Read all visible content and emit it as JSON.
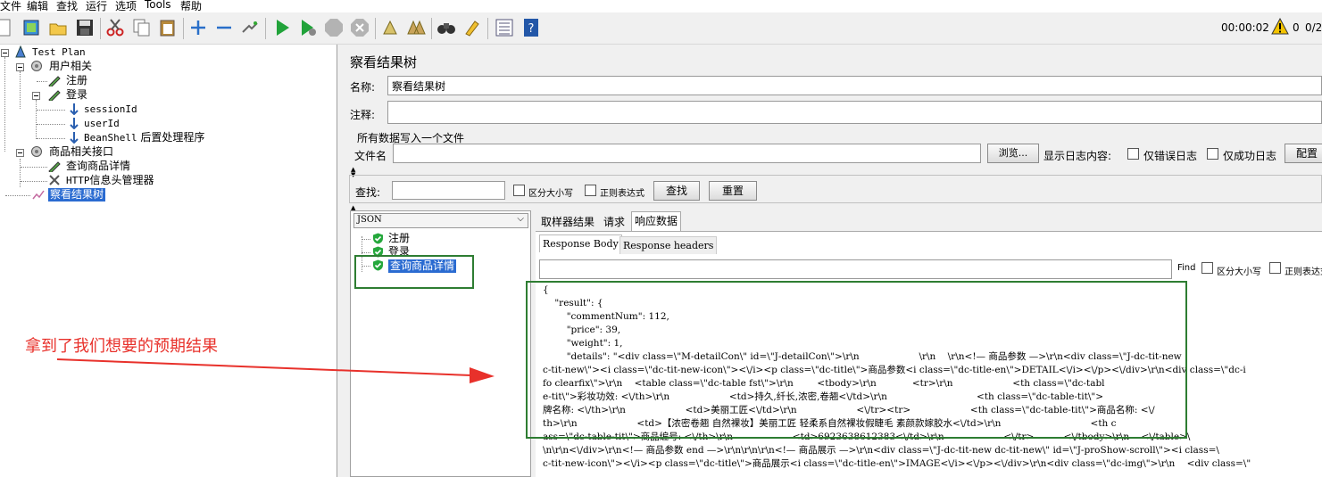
{
  "menu": [
    "文件",
    "编辑",
    "查找",
    "运行",
    "选项",
    "Tools",
    "帮助"
  ],
  "toolbar": {
    "icons": [
      "new-icon",
      "templates-icon",
      "open-icon",
      "save-icon",
      "cut-icon",
      "copy-icon",
      "paste-icon",
      "expand-icon",
      "collapse-icon",
      "toggle-icon",
      "start-icon",
      "start-no-pause-icon",
      "stop-icon",
      "shutdown-icon",
      "clear-icon",
      "clear-all-icon",
      "search-icon",
      "reset-search-icon",
      "function-helper-icon",
      "help-icon"
    ],
    "timer": "00:00:02",
    "warnings": "0",
    "threads": "0/2"
  },
  "tree": {
    "test_plan": "Test Plan",
    "user_group": "用户相关",
    "register": "注册",
    "login": "登录",
    "session_id": "sessionId",
    "user_id": "userId",
    "beanshell_prefix": "BeanShell",
    "beanshell_suffix": " 后置处理程序",
    "product_group": "商品相关接口",
    "query_detail": "查询商品详情",
    "http_header_prefix": "HTTP",
    "http_header_suffix": "信息头管理器",
    "view_results": "察看结果树"
  },
  "panel": {
    "title": "察看结果树",
    "name_label": "名称:",
    "name_value": "察看结果树",
    "comment_label": "注释:",
    "comment_value": "",
    "write_all_label": "所有数据写入一个文件",
    "filename_label": "文件名",
    "filename_value": "",
    "browse_button": "浏览...",
    "log_display_label": "显示日志内容:",
    "errors_only": "仅错误日志",
    "success_only": "仅成功日志",
    "configure_button": "配置",
    "search_label": "查找:",
    "search_value": "",
    "case_sensitive": "区分大小写",
    "regex": "正则表达式",
    "search_button": "查找",
    "reset_button": "重置"
  },
  "results": {
    "renderer": "JSON",
    "samples": [
      "注册",
      "登录",
      "查询商品详情"
    ],
    "tabs": [
      "取样器结果",
      "请求",
      "响应数据"
    ],
    "subtabs": [
      "Response Body",
      "Response headers"
    ],
    "find_label": "Find",
    "find_value": "",
    "find_case": "区分大小写",
    "find_regex": "正则表达式"
  },
  "response_lines": [
    "{",
    "    \"result\": {",
    "        \"commentNum\": 112,",
    "        \"price\": 39,",
    "        \"weight\": 1,",
    "        \"details\": \"<div class=\\\"M-detailCon\\\" id=\\\"J-detailCon\\\">\\r\\n                    \\r\\n    \\r\\n<!— 商品参数 —>\\r\\n<div class=\\\"J-dc-tit-new",
    "c-tit-new\\\"><i class=\\\"dc-tit-new-icon\\\"><\\/i><p class=\\\"dc-title\\\">商品参数<i class=\\\"dc-title-en\\\">DETAIL<\\/i><\\/p><\\/div>\\r\\n<div class=\\\"dc-i",
    "fo clearfix\\\">\\r\\n    <table class=\\\"dc-table fst\\\">\\r\\n        <tbody>\\r\\n            <tr>\\r\\n                    <th class=\\\"dc-tabl",
    "e-tit\\\">彩妆功效: <\\/th>\\r\\n                    <td>持久,纤长,浓密,卷翘<\\/td>\\r\\n                              <th class=\\\"dc-table-tit\\\">",
    "牌名称: <\\/th>\\r\\n                    <td>美丽工匠<\\/td>\\r\\n                    <\\/tr><tr>                    <th class=\\\"dc-table-tit\\\">商品名称: <\\/",
    "th>\\r\\n                    <td>【浓密卷翘 自然裸妆】美丽工匠 轻柔系自然裸妆假睫毛 素颜款嫁胶水<\\/td>\\r\\n                              <th c",
    "ass=\\\"dc-table-tit\\\">商品编号: <\\/th>\\r\\n                    <td>6923638612383<\\/td>\\r\\n                    <\\/tr>          <\\/tbody>\\r\\n    <\\/table>\\",
    "\\n\\r\\n<\\/div>\\r\\n<!— 商品参数 end —>\\r\\n\\r\\n\\r\\n<!— 商品展示 —>\\r\\n<div class=\\\"J-dc-tit-new dc-tit-new\\\" id=\\\"J-proShow-scroll\\\"><i class=\\",
    "c-tit-new-icon\\\"><\\/i><p class=\\\"dc-title\\\">商品展示<i class=\\\"dc-title-en\\\">IMAGE<\\/i><\\/p><\\/div>\\r\\n<div class=\\\"dc-img\\\">\\r\\n    <div class=\\\""
  ],
  "annotation": {
    "text": "拿到了我们想要的预期结果",
    "color": "#e8312b",
    "box_color": "#2e7d32"
  }
}
